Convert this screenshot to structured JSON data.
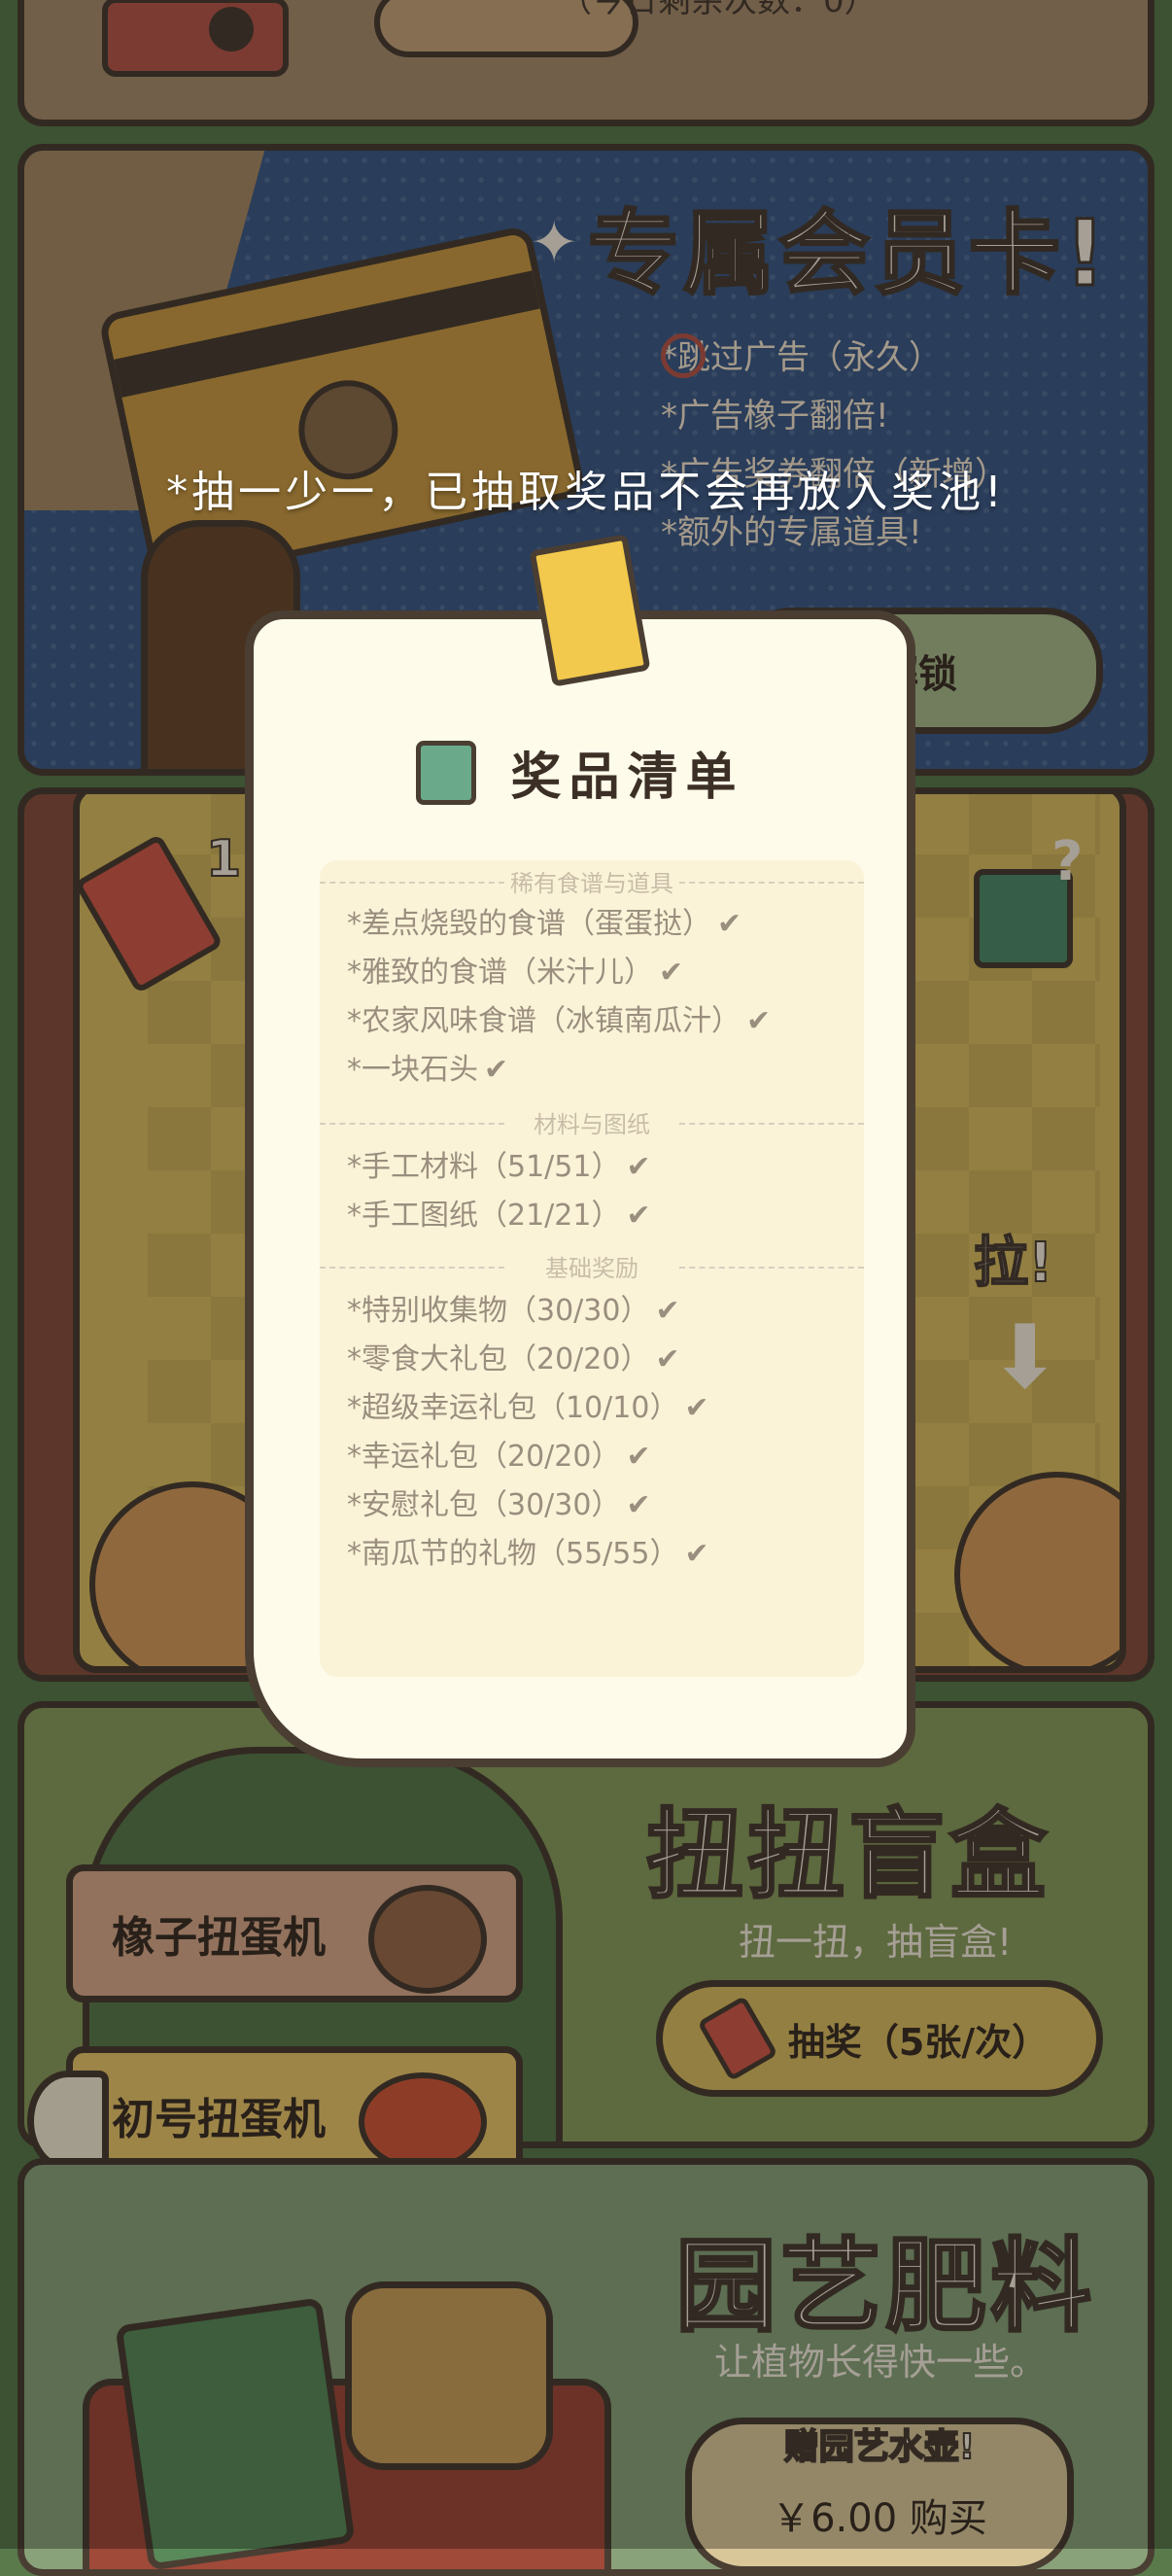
{
  "top_strip": {
    "text": "（今日剩余次数：0）"
  },
  "member_card": {
    "title": "专属会员卡!",
    "perks": [
      "*跳过广告（永久）",
      "*广告橡子翻倍!",
      "*广告奖券翻倍（新增）",
      "*额外的专属道具!"
    ],
    "button_label": "解锁",
    "bg_color": "#3e5a85"
  },
  "notice": "*抽一少一，已抽取奖品不会再放入奖池!",
  "lottery": {
    "ticket_count": "1",
    "pull_label": "拉!",
    "bg_color": "#d9bb61"
  },
  "prize_list": {
    "title": "奖品清单",
    "sections": [
      {
        "name": "稀有食谱与道具",
        "items": [
          "*差点烧毁的食谱（蛋蛋挞）",
          "*雅致的食谱（米汁儿）",
          "*农家风味食谱（冰镇南瓜汁）",
          "*一块石头"
        ]
      },
      {
        "name": "材料与图纸",
        "items": [
          "*手工材料（51/51）",
          "*手工图纸（21/21）"
        ]
      },
      {
        "name": "基础奖励",
        "items": [
          "*特别收集物（30/30）",
          "*零食大礼包（20/20）",
          "*超级幸运礼包（10/10）",
          "*幸运礼包（20/20）",
          "*安慰礼包（30/30）",
          "*南瓜节的礼物（55/55）"
        ]
      }
    ]
  },
  "gacha": {
    "title": "扭扭盲盒",
    "subtitle": "扭一扭，抽盲盒!",
    "button_label": "抽奖（5张/次）",
    "side_tabs": [
      "橡子扭蛋机",
      "初号扭蛋机"
    ],
    "bg_color": "#8a9b5c"
  },
  "fertilizer": {
    "title": "园艺肥料",
    "subtitle": "让植物长得快一些。",
    "badge": "赠园艺水壶!",
    "price_label": "￥6.00 购买",
    "bg_color": "#8aa27a"
  }
}
